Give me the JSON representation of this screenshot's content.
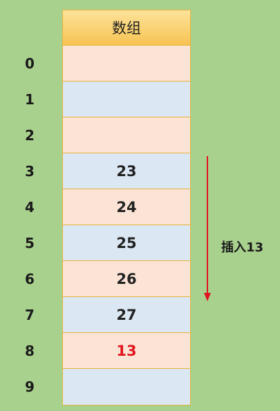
{
  "table": {
    "header": "数组",
    "rows": [
      {
        "index": "0",
        "value": ""
      },
      {
        "index": "1",
        "value": ""
      },
      {
        "index": "2",
        "value": ""
      },
      {
        "index": "3",
        "value": "23"
      },
      {
        "index": "4",
        "value": "24"
      },
      {
        "index": "5",
        "value": "25"
      },
      {
        "index": "6",
        "value": "26"
      },
      {
        "index": "7",
        "value": "27"
      },
      {
        "index": "8",
        "value": "13"
      },
      {
        "index": "9",
        "value": ""
      }
    ]
  },
  "annotation": {
    "label": "插入13"
  },
  "colors": {
    "background": "#a9d18e",
    "header": "#f7c353",
    "cell_peach": "#fbe4d5",
    "cell_blue": "#dbe7f3",
    "highlight": "#e0141e",
    "arrow": "#e0141e"
  }
}
